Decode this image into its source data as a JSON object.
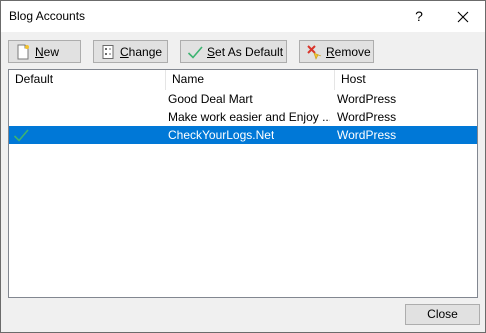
{
  "window": {
    "title": "Blog Accounts",
    "help_label": "?"
  },
  "toolbar": {
    "new_label_u": "N",
    "new_label_rest": "ew",
    "change_label_u": "C",
    "change_label_rest": "hange",
    "default_label_u": "S",
    "default_label_rest": "et As Default",
    "remove_label_u": "R",
    "remove_label_rest": "emove"
  },
  "table": {
    "headers": [
      "Default",
      "Name",
      "Host"
    ],
    "rows": [
      {
        "default": "",
        "name": "Good Deal Mart",
        "host": "WordPress"
      },
      {
        "default": "",
        "name": "Make work easier and Enjoy ...",
        "host": "WordPress"
      },
      {
        "default": "check",
        "name": "CheckYourLogs.Net",
        "host": "WordPress"
      }
    ],
    "selected_row": 2
  },
  "footer": {
    "close_label": "Close"
  },
  "colors": {
    "selection": "#0078d7",
    "check": "#3cb371"
  },
  "icons": [
    "new-document-icon",
    "change-icon",
    "checkmark-icon",
    "remove-icon",
    "close-icon"
  ]
}
